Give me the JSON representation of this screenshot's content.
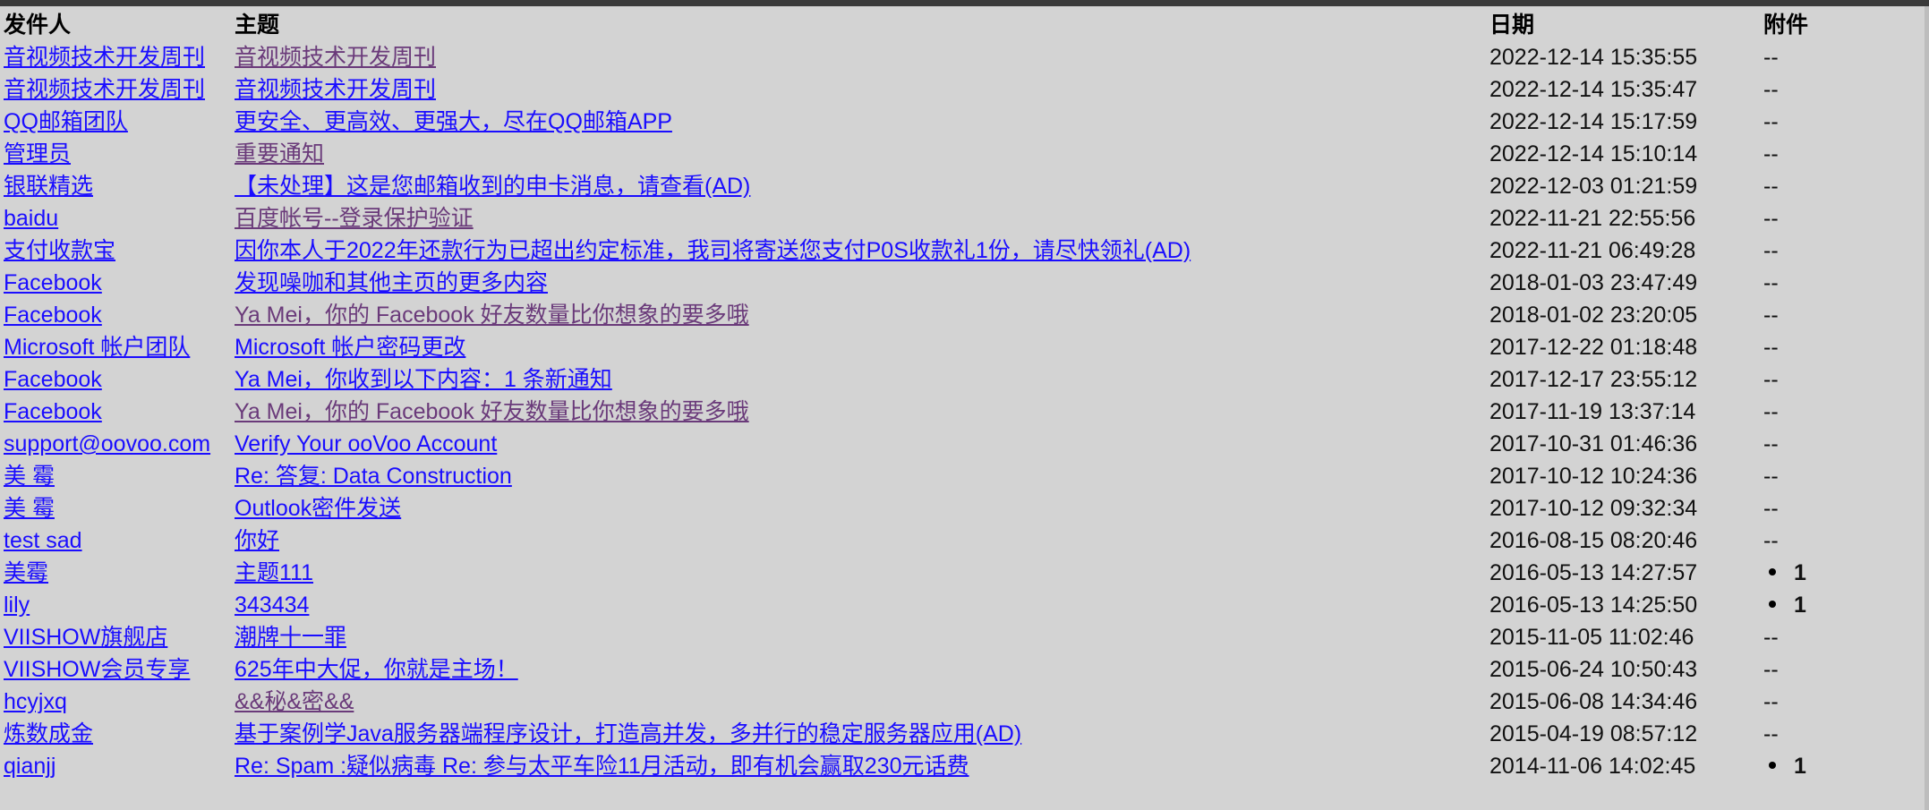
{
  "columns": {
    "sender": "发件人",
    "subject": "主题",
    "date": "日期",
    "attachment": "附件"
  },
  "emails": [
    {
      "sender": "音视频技术开发周刊",
      "subject": "音视频技术开发周刊",
      "date": "2022-12-14 15:35:55",
      "attachment": "--",
      "visited": true
    },
    {
      "sender": "音视频技术开发周刊",
      "subject": "音视频技术开发周刊",
      "date": "2022-12-14 15:35:47",
      "attachment": "--",
      "visited": false
    },
    {
      "sender": "QQ邮箱团队",
      "subject": "更安全、更高效、更强大，尽在QQ邮箱APP",
      "date": "2022-12-14 15:17:59",
      "attachment": "--",
      "visited": false
    },
    {
      "sender": "管理员",
      "subject": "重要通知",
      "date": "2022-12-14 15:10:14",
      "attachment": "--",
      "visited": true
    },
    {
      "sender": "银联精选",
      "subject": "【未处理】这是您邮箱收到的申卡消息，请查看(AD)",
      "date": "2022-12-03 01:21:59",
      "attachment": "--",
      "visited": false
    },
    {
      "sender": "baidu",
      "subject": "百度帐号--登录保护验证",
      "date": "2022-11-21 22:55:56",
      "attachment": "--",
      "visited": true
    },
    {
      "sender": "支付收款宝",
      "subject": "因你本人于2022年还款行为已超出约定标准，我司将寄送您支付P0S收款礼1份，请尽快领礼(AD)",
      "date": "2022-11-21 06:49:28",
      "attachment": "--",
      "visited": false
    },
    {
      "sender": "Facebook",
      "subject": "发现噪咖和其他主页的更多内容",
      "date": "2018-01-03 23:47:49",
      "attachment": "--",
      "visited": false
    },
    {
      "sender": "Facebook",
      "subject": "Ya Mei，你的 Facebook 好友数量比你想象的要多哦",
      "date": "2018-01-02 23:20:05",
      "attachment": "--",
      "visited": true
    },
    {
      "sender": "Microsoft 帐户团队",
      "subject": "Microsoft 帐户密码更改",
      "date": "2017-12-22 01:18:48",
      "attachment": "--",
      "visited": false
    },
    {
      "sender": "Facebook",
      "subject": "Ya Mei，你收到以下内容：1 条新通知",
      "date": "2017-12-17 23:55:12",
      "attachment": "--",
      "visited": false
    },
    {
      "sender": "Facebook",
      "subject": "Ya Mei，你的 Facebook 好友数量比你想象的要多哦",
      "date": "2017-11-19 13:37:14",
      "attachment": "--",
      "visited": true
    },
    {
      "sender": "support@oovoo.com",
      "subject": "Verify Your ooVoo Account",
      "date": "2017-10-31 01:46:36",
      "attachment": "--",
      "visited": false
    },
    {
      "sender": "美 霉",
      "subject": "Re: 答复: Data Construction",
      "date": "2017-10-12 10:24:36",
      "attachment": "--",
      "visited": false
    },
    {
      "sender": "美 霉",
      "subject": "Outlook密件发送",
      "date": "2017-10-12 09:32:34",
      "attachment": "--",
      "visited": false
    },
    {
      "sender": "test sad",
      "subject": "你好",
      "date": "2016-08-15 08:20:46",
      "attachment": "--",
      "visited": false
    },
    {
      "sender": "美霉",
      "subject": "主题111",
      "date": "2016-05-13 14:27:57",
      "attachment": "1",
      "visited": false
    },
    {
      "sender": "lily",
      "subject": "343434",
      "date": "2016-05-13 14:25:50",
      "attachment": "1",
      "visited": false
    },
    {
      "sender": "VIISHOW旗舰店",
      "subject": "潮牌十一罪",
      "date": "2015-11-05 11:02:46",
      "attachment": "--",
      "visited": false
    },
    {
      "sender": "VIISHOW会员专享",
      "subject": "625年中大促，你就是主场！",
      "date": "2015-06-24 10:50:43",
      "attachment": "--",
      "visited": false
    },
    {
      "sender": "hcyjxq",
      "subject": "&&秘&密&&",
      "date": "2015-06-08 14:34:46",
      "attachment": "--",
      "visited": true
    },
    {
      "sender": "炼数成金",
      "subject": "基于案例学Java服务器端程序设计，打造高并发，多并行的稳定服务器应用(AD)",
      "date": "2015-04-19 08:57:12",
      "attachment": "--",
      "visited": false
    },
    {
      "sender": "qianjj",
      "subject": "Re: Spam :疑似病毒 Re: 参与太平车险11月活动，即有机会赢取230元话费",
      "date": "2014-11-06 14:02:45",
      "attachment": "1",
      "visited": false
    }
  ],
  "colors": {
    "background": "#d3d3d3",
    "link": "#1a0dff",
    "visited_link": "#6a3a7a",
    "text": "#111111"
  }
}
